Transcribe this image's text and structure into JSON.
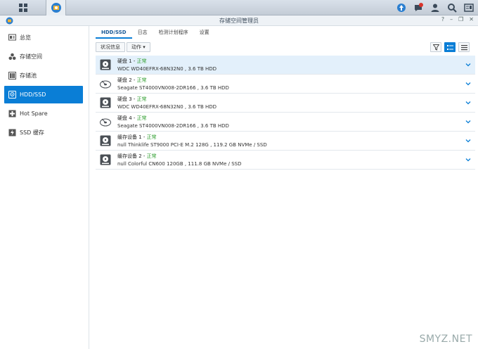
{
  "window": {
    "title": "存储空间管理员"
  },
  "sidebar": {
    "items": [
      {
        "label": "总览"
      },
      {
        "label": "存储空间"
      },
      {
        "label": "存储池"
      },
      {
        "label": "HDD/SSD"
      },
      {
        "label": "Hot Spare"
      },
      {
        "label": "SSD 缓存"
      }
    ]
  },
  "tabs": [
    {
      "label": "HDD/SSD"
    },
    {
      "label": "日志"
    },
    {
      "label": "检测计划程序"
    },
    {
      "label": "设置"
    }
  ],
  "toolbar": {
    "status_label": "状况信息",
    "action_label": "动作 ▾"
  },
  "disks": [
    {
      "name": "硬盘 1",
      "status": "正常",
      "desc": "WDC WD40EFRX-68N32N0 , 3.6 TB HDD",
      "icon": "hdd-icon"
    },
    {
      "name": "硬盘 2",
      "status": "正常",
      "desc": "Seagate ST4000VN008-2DR166 , 3.6 TB HDD",
      "icon": "disk-platter-icon"
    },
    {
      "name": "硬盘 3",
      "status": "正常",
      "desc": "WDC WD40EFRX-68N32N0 , 3.6 TB HDD",
      "icon": "hdd-icon"
    },
    {
      "name": "硬盘 4",
      "status": "正常",
      "desc": "Seagate ST4000VN008-2DR166 , 3.6 TB HDD",
      "icon": "disk-platter-icon"
    },
    {
      "name": "缓存设备 1",
      "status": "正常",
      "desc": "null Thinklife ST9000 PCI-E M.2 128G , 119.2 GB NVMe / SSD",
      "icon": "hdd-icon"
    },
    {
      "name": "缓存设备 2",
      "status": "正常",
      "desc": "null Colorful CN600 120GB , 111.8 GB NVMe / SSD",
      "icon": "hdd-icon"
    }
  ],
  "watermark": "SMYZ.NET",
  "colors": {
    "accent": "#0a7ed6",
    "status_ok": "#2e9e2e"
  }
}
